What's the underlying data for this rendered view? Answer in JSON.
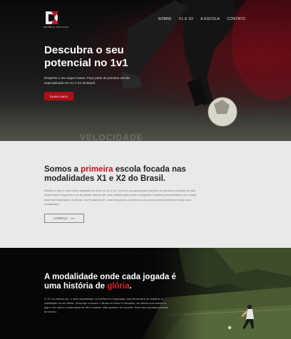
{
  "brand": {
    "logo_text": "DK",
    "tagline": "DRIBBLE AND KICK"
  },
  "nav": {
    "items": [
      "SOBRE",
      "X1 E X2",
      "A ESCOLA",
      "CONTATO"
    ]
  },
  "hero": {
    "title": "Descubra o seu potencial no 1v1",
    "subtitle": "Desperte o seu toque insano. Faça parte da primeira escola especializada em X1 e X2 do Brasil.",
    "cta": "SAIBA MAIS",
    "faded_text": "VELOCIDADE"
  },
  "about": {
    "title_pre": "Somos a ",
    "title_highlight": "primeira",
    "title_post": " escola focada nas modalidades X1 e X2 do Brasil.",
    "body": "Dribble & Kick é uma nova realidade no setor do X1 e X2, um novo programa que oferece um percurso inovador de alto performance esportivo e de formação através de uma metodologia única e integrada. Estamos presenciando com nossa base de treinamento no Brasil, em Fortaleza-CE, onde buscamos a formar na os nossos jovens talentos dessa nova modalidade.",
    "cta": "COMEÇA",
    "cta_arrow": "⟶"
  },
  "mode": {
    "title_pre": "A modalidade onde cada jogada é uma história de ",
    "title_highlight": "glória",
    "title_post": ".",
    "body": "O X1 ou versus um, é uma modalidade do futebol em expansão, que demonstra ao máximo a habilidade de um atleta. Desculpe conosco o Brasil no futuro e desafios, de dobrar sua marca no jogo e de aderir à adrenalina de até a estrela. Não apenas um esporte. Esta uma jornada pessoal de triunfo."
  },
  "colors": {
    "accent": "#c8101f",
    "light_bg": "#e9e9e9",
    "dark_bg": "#0a0a0a"
  }
}
